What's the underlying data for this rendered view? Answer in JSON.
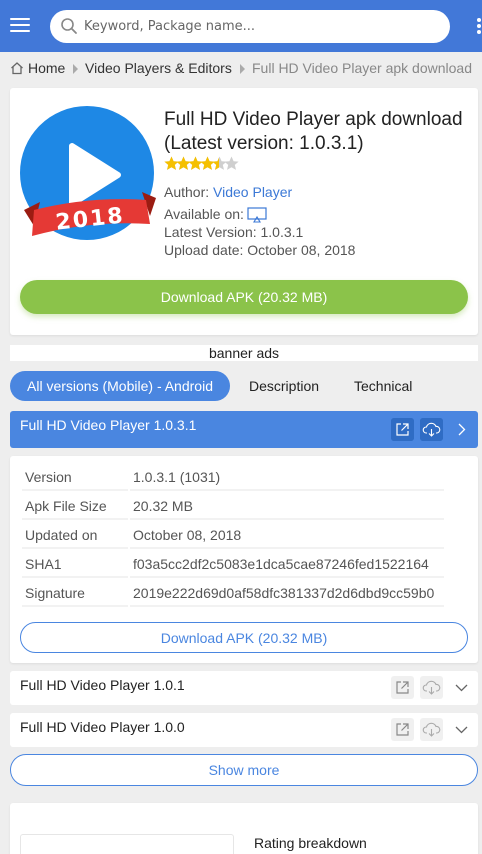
{
  "header": {
    "search_placeholder": "Keyword, Package name...",
    "icons": [
      "menu-icon",
      "search-icon",
      "more-vert-icon"
    ],
    "accent_color": "#4278d8"
  },
  "breadcrumb": {
    "home": "Home",
    "category": "Video Players & Editors",
    "current": "Full HD Video Player apk download"
  },
  "app": {
    "title": "Full HD Video Player apk download (Latest version: 1.0.3.1)",
    "rating_stars": 4.5,
    "icon_badge": "2018",
    "author_label": "Author:",
    "author": "Video Player",
    "available_label": "Available on:",
    "latest_version": "Latest Version: 1.0.3.1",
    "upload_date": "Upload date: October 08, 2018",
    "download_label": "Download APK (20.32 MB)",
    "download_color": "#8bc34a"
  },
  "banner": "banner ads",
  "tabs": [
    "All versions (Mobile) - Android",
    "Description",
    "Technical"
  ],
  "versions": {
    "expanded": {
      "title": "Full HD Video Player 1.0.3.1",
      "rows": [
        {
          "key": "Version",
          "value": "1.0.3.1 (1031)"
        },
        {
          "key": "Apk File Size",
          "value": "20.32 MB"
        },
        {
          "key": "Updated on",
          "value": "October 08, 2018"
        },
        {
          "key": "SHA1",
          "value": "f03a5cc2df2c5083e1dca5cae87246fed1522164"
        },
        {
          "key": "Signature",
          "value": "2019e222d69d0af58dfc381337d2d6dbd9cc59b0"
        }
      ],
      "download_label": "Download APK (20.32 MB)"
    },
    "collapsed": [
      {
        "title": "Full HD Video Player 1.0.1"
      },
      {
        "title": "Full HD Video Player 1.0.0"
      }
    ],
    "show_more": "Show more"
  },
  "rating": {
    "title": "Rating breakdown"
  }
}
